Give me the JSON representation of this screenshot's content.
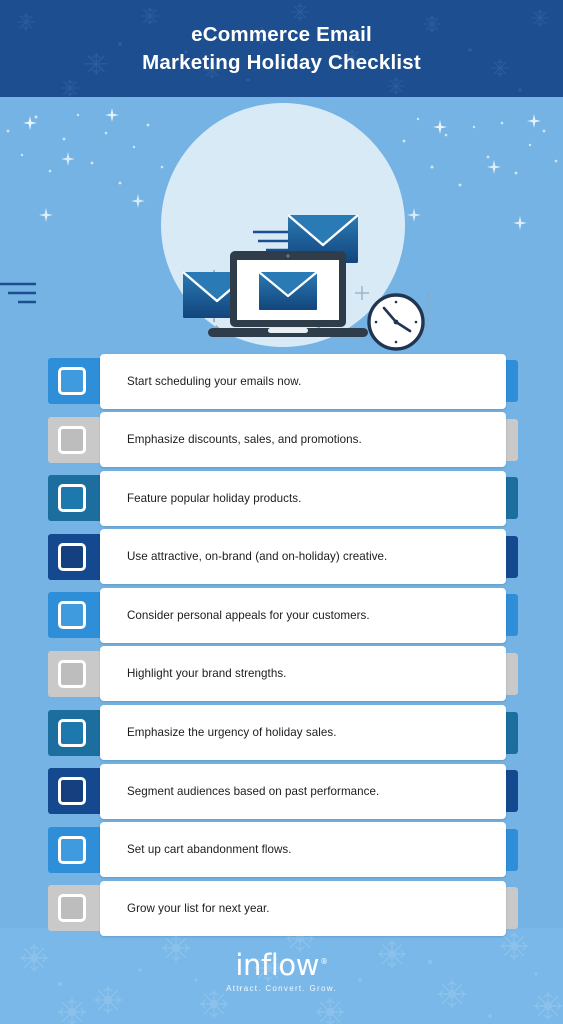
{
  "header": {
    "title_line1": "eCommerce Email",
    "title_line2": "Marketing Holiday Checklist",
    "bg_color": "#1d4e8f",
    "text_color": "#ffffff"
  },
  "page": {
    "background_color": "#74b3e3",
    "footer_band_color": "#79b8e8",
    "card_color": "#ffffff",
    "card_text_color": "#1c1c1c"
  },
  "hero": {
    "description": "Illustration of three email envelopes connected by dashed lines to a laptop showing an email, with an analog clock, on a pale circular backdrop with falling glitter",
    "circle_color": "#d5e8f6",
    "envelope_light": "#2a78b2",
    "envelope_dark": "#17538c",
    "laptop_color": "#2f3c4a",
    "clock_face": "#ffffff",
    "clock_ring": "#1f3551"
  },
  "checklist": {
    "items": [
      {
        "label": "Start scheduling your emails now.",
        "accent": "#2e8fd8",
        "checkbox_fill": "#3f9ade"
      },
      {
        "label": "Emphasize discounts, sales, and promotions.",
        "accent": "#c9c9c9",
        "checkbox_fill": "#bdbdbd"
      },
      {
        "label": "Feature popular holiday products.",
        "accent": "#1b6e9e",
        "checkbox_fill": "#1d79ad"
      },
      {
        "label": "Use attractive, on-brand (and on-holiday) creative.",
        "accent": "#14498f",
        "checkbox_fill": "#153f7e"
      },
      {
        "label": "Consider personal appeals for your customers.",
        "accent": "#2e8fd8",
        "checkbox_fill": "#3f9ade"
      },
      {
        "label": "Highlight your brand strengths.",
        "accent": "#c9c9c9",
        "checkbox_fill": "#bdbdbd"
      },
      {
        "label": "Emphasize the urgency of holiday sales.",
        "accent": "#1b6e9e",
        "checkbox_fill": "#1d79ad"
      },
      {
        "label": "Segment audiences based on past performance.",
        "accent": "#14498f",
        "checkbox_fill": "#153f7e"
      },
      {
        "label": "Set up cart abandonment flows.",
        "accent": "#2e8fd8",
        "checkbox_fill": "#3f9ade"
      },
      {
        "label": "Grow your list for next year.",
        "accent": "#c9c9c9",
        "checkbox_fill": "#bdbdbd"
      }
    ]
  },
  "footer": {
    "logo_text": "inflow",
    "logo_trademark": "®",
    "tagline": "Attract. Convert. Grow."
  }
}
